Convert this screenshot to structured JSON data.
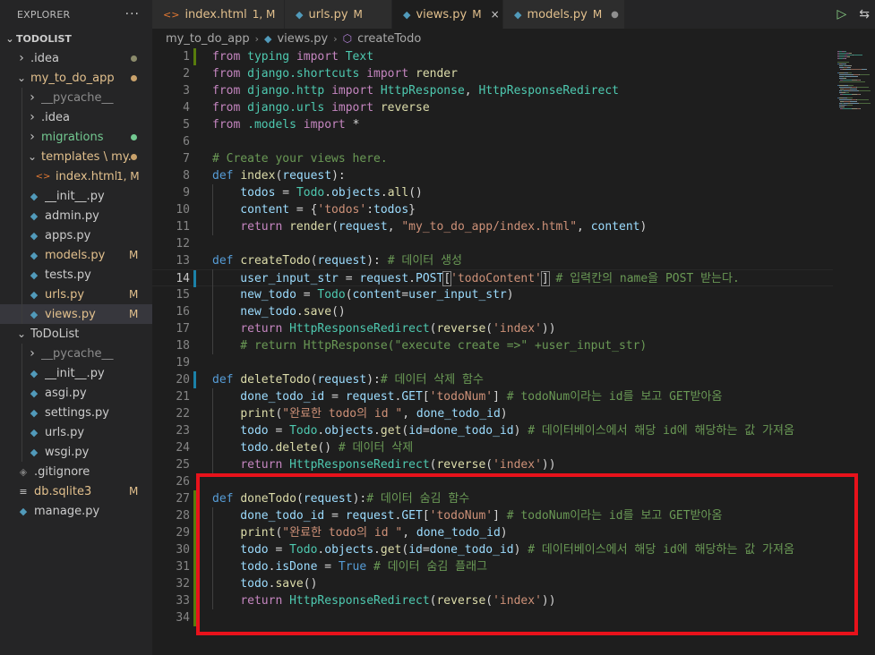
{
  "explorer": {
    "title": "EXPLORER",
    "more_icon": "ellipsis-icon",
    "root": "TODOLIST",
    "items": [
      {
        "label": ".idea",
        "kind": "folder",
        "open": false,
        "depth": 1,
        "color": "#cccccc",
        "dot": "#8b8b6b"
      },
      {
        "label": "my_to_do_app",
        "kind": "folder",
        "open": true,
        "depth": 1,
        "color": "#e2c08d",
        "dot": "#c9a26b"
      },
      {
        "label": "__pycache__",
        "kind": "folder",
        "open": false,
        "depth": 2,
        "color": "#8c8c8c"
      },
      {
        "label": ".idea",
        "kind": "folder",
        "open": false,
        "depth": 2,
        "color": "#cccccc"
      },
      {
        "label": "migrations",
        "kind": "folder",
        "open": false,
        "depth": 2,
        "color": "#73c991",
        "dot": "#73c991"
      },
      {
        "label": "templates \\ my...",
        "kind": "folder",
        "open": true,
        "depth": 2,
        "color": "#e2c08d",
        "dot": "#c9a26b"
      },
      {
        "label": "index.html",
        "kind": "html",
        "depth": 3,
        "color": "#e2c08d",
        "badge": "1, M",
        "badge_color": "#e2c08d"
      },
      {
        "label": "__init__.py",
        "kind": "py",
        "depth": 2,
        "color": "#cccccc"
      },
      {
        "label": "admin.py",
        "kind": "py",
        "depth": 2,
        "color": "#cccccc"
      },
      {
        "label": "apps.py",
        "kind": "py",
        "depth": 2,
        "color": "#cccccc"
      },
      {
        "label": "models.py",
        "kind": "py",
        "depth": 2,
        "color": "#e2c08d",
        "badge": "M",
        "badge_color": "#e2c08d"
      },
      {
        "label": "tests.py",
        "kind": "py",
        "depth": 2,
        "color": "#cccccc"
      },
      {
        "label": "urls.py",
        "kind": "py",
        "depth": 2,
        "color": "#e2c08d",
        "badge": "M",
        "badge_color": "#e2c08d"
      },
      {
        "label": "views.py",
        "kind": "py",
        "depth": 2,
        "color": "#e2c08d",
        "badge": "M",
        "badge_color": "#e2c08d",
        "selected": true
      },
      {
        "label": "ToDoList",
        "kind": "folder",
        "open": true,
        "depth": 1,
        "color": "#cccccc"
      },
      {
        "label": "__pycache__",
        "kind": "folder",
        "open": false,
        "depth": 2,
        "color": "#8c8c8c"
      },
      {
        "label": "__init__.py",
        "kind": "py",
        "depth": 2,
        "color": "#cccccc"
      },
      {
        "label": "asgi.py",
        "kind": "py",
        "depth": 2,
        "color": "#cccccc"
      },
      {
        "label": "settings.py",
        "kind": "py",
        "depth": 2,
        "color": "#cccccc"
      },
      {
        "label": "urls.py",
        "kind": "py",
        "depth": 2,
        "color": "#cccccc"
      },
      {
        "label": "wsgi.py",
        "kind": "py",
        "depth": 2,
        "color": "#cccccc"
      },
      {
        "label": ".gitignore",
        "kind": "file",
        "depth": 1,
        "color": "#cccccc"
      },
      {
        "label": "db.sqlite3",
        "kind": "db",
        "depth": 1,
        "color": "#e2c08d",
        "badge": "M",
        "badge_color": "#e2c08d"
      },
      {
        "label": "manage.py",
        "kind": "py",
        "depth": 1,
        "color": "#cccccc"
      }
    ]
  },
  "tabs": [
    {
      "label": "index.html",
      "badge": "1, M",
      "icon": "html-icon",
      "active": false,
      "close": "×"
    },
    {
      "label": "urls.py",
      "badge": "M",
      "icon": "python-icon",
      "active": false,
      "close": ""
    },
    {
      "label": "views.py",
      "badge": "M",
      "icon": "python-icon",
      "active": true,
      "close": "×"
    },
    {
      "label": "models.py",
      "badge": "M",
      "icon": "python-icon",
      "active": false,
      "close": "●"
    }
  ],
  "tab_actions": {
    "run": "▷",
    "compare": "⇆"
  },
  "breadcrumb": {
    "folder": "my_to_do_app",
    "file": "views.py",
    "symbol": "createTodo",
    "sep": "›"
  },
  "editor": {
    "current_line": 14,
    "lines": [
      [
        [
          "from ",
          "kc"
        ],
        [
          "typing ",
          "cls"
        ],
        [
          "import ",
          "kc"
        ],
        [
          "Text",
          "cls"
        ]
      ],
      [
        [
          "from ",
          "kc"
        ],
        [
          "django.shortcuts ",
          "cls"
        ],
        [
          "import ",
          "kc"
        ],
        [
          "render",
          "fn"
        ]
      ],
      [
        [
          "from ",
          "kc"
        ],
        [
          "django.http ",
          "cls"
        ],
        [
          "import ",
          "kc"
        ],
        [
          "HttpResponse",
          "cls"
        ],
        [
          ", ",
          "pl"
        ],
        [
          "HttpResponseRedirect",
          "cls"
        ]
      ],
      [
        [
          "from ",
          "kc"
        ],
        [
          "django.urls ",
          "cls"
        ],
        [
          "import ",
          "kc"
        ],
        [
          "reverse",
          "fn"
        ]
      ],
      [
        [
          "from ",
          "kc"
        ],
        [
          ".models ",
          "cls"
        ],
        [
          "import ",
          "kc"
        ],
        [
          "*",
          "pl"
        ]
      ],
      [],
      [
        [
          "# Create your views here.",
          "cm"
        ]
      ],
      [
        [
          "def ",
          "kw"
        ],
        [
          "index",
          "fn"
        ],
        [
          "(",
          "pl"
        ],
        [
          "request",
          "var"
        ],
        [
          "):",
          "pl"
        ]
      ],
      [
        [
          "    todos ",
          "var"
        ],
        [
          "= ",
          "pl"
        ],
        [
          "Todo",
          "cls"
        ],
        [
          ".",
          "pl"
        ],
        [
          "objects",
          "var"
        ],
        [
          ".",
          "pl"
        ],
        [
          "all",
          "fn"
        ],
        [
          "()",
          "pl"
        ]
      ],
      [
        [
          "    content ",
          "var"
        ],
        [
          "= {",
          "pl"
        ],
        [
          "'todos'",
          "str"
        ],
        [
          ":",
          "pl"
        ],
        [
          "todos",
          "var"
        ],
        [
          "}",
          "pl"
        ]
      ],
      [
        [
          "    ",
          "pl"
        ],
        [
          "return ",
          "kc"
        ],
        [
          "render",
          "fn"
        ],
        [
          "(",
          "pl"
        ],
        [
          "request",
          "var"
        ],
        [
          ", ",
          "pl"
        ],
        [
          "\"my_to_do_app/index.html\"",
          "str"
        ],
        [
          ", ",
          "pl"
        ],
        [
          "content",
          "var"
        ],
        [
          ")",
          "pl"
        ]
      ],
      [],
      [
        [
          "def ",
          "kw"
        ],
        [
          "createTodo",
          "fn"
        ],
        [
          "(",
          "pl"
        ],
        [
          "request",
          "var"
        ],
        [
          "): ",
          "pl"
        ],
        [
          "# 데이터 생성",
          "cm"
        ]
      ],
      [
        [
          "    user_input_str ",
          "var"
        ],
        [
          "= ",
          "pl"
        ],
        [
          "request",
          "var"
        ],
        [
          ".",
          "pl"
        ],
        [
          "POST",
          "var"
        ],
        [
          "[",
          "pl"
        ],
        [
          "'todoContent'",
          "str"
        ],
        [
          "] ",
          "pl"
        ],
        [
          "# 입력칸의 name을 POST 받는다.",
          "cm"
        ]
      ],
      [
        [
          "    new_todo ",
          "var"
        ],
        [
          "= ",
          "pl"
        ],
        [
          "Todo",
          "cls"
        ],
        [
          "(",
          "pl"
        ],
        [
          "content",
          "var"
        ],
        [
          "=",
          "pl"
        ],
        [
          "user_input_str",
          "var"
        ],
        [
          ")",
          "pl"
        ]
      ],
      [
        [
          "    new_todo",
          "var"
        ],
        [
          ".",
          "pl"
        ],
        [
          "save",
          "fn"
        ],
        [
          "()",
          "pl"
        ]
      ],
      [
        [
          "    ",
          "pl"
        ],
        [
          "return ",
          "kc"
        ],
        [
          "HttpResponseRedirect",
          "cls"
        ],
        [
          "(",
          "pl"
        ],
        [
          "reverse",
          "fn"
        ],
        [
          "(",
          "pl"
        ],
        [
          "'index'",
          "str"
        ],
        [
          "))",
          "pl"
        ]
      ],
      [
        [
          "    # return HttpResponse(\"execute create =>\" +user_input_str)",
          "cm"
        ]
      ],
      [],
      [
        [
          "def ",
          "kw"
        ],
        [
          "deleteTodo",
          "fn"
        ],
        [
          "(",
          "pl"
        ],
        [
          "request",
          "var"
        ],
        [
          "):",
          "pl"
        ],
        [
          "# 데이터 삭제 함수",
          "cm"
        ]
      ],
      [
        [
          "    done_todo_id ",
          "var"
        ],
        [
          "= ",
          "pl"
        ],
        [
          "request",
          "var"
        ],
        [
          ".",
          "pl"
        ],
        [
          "GET",
          "var"
        ],
        [
          "[",
          "pl"
        ],
        [
          "'todoNum'",
          "str"
        ],
        [
          "] ",
          "pl"
        ],
        [
          "# todoNum이라는 id를 보고 GET받아옴",
          "cm"
        ]
      ],
      [
        [
          "    ",
          "pl"
        ],
        [
          "print",
          "fn"
        ],
        [
          "(",
          "pl"
        ],
        [
          "\"완료한 todo의 id \"",
          "str"
        ],
        [
          ", ",
          "pl"
        ],
        [
          "done_todo_id",
          "var"
        ],
        [
          ")",
          "pl"
        ]
      ],
      [
        [
          "    todo ",
          "var"
        ],
        [
          "= ",
          "pl"
        ],
        [
          "Todo",
          "cls"
        ],
        [
          ".",
          "pl"
        ],
        [
          "objects",
          "var"
        ],
        [
          ".",
          "pl"
        ],
        [
          "get",
          "fn"
        ],
        [
          "(",
          "pl"
        ],
        [
          "id",
          "var"
        ],
        [
          "=",
          "pl"
        ],
        [
          "done_todo_id",
          "var"
        ],
        [
          ") ",
          "pl"
        ],
        [
          "# 데이터베이스에서 해당 id에 해당하는 값 가져옴",
          "cm"
        ]
      ],
      [
        [
          "    todo",
          "var"
        ],
        [
          ".",
          "pl"
        ],
        [
          "delete",
          "fn"
        ],
        [
          "() ",
          "pl"
        ],
        [
          "# 데이터 삭제",
          "cm"
        ]
      ],
      [
        [
          "    ",
          "pl"
        ],
        [
          "return ",
          "kc"
        ],
        [
          "HttpResponseRedirect",
          "cls"
        ],
        [
          "(",
          "pl"
        ],
        [
          "reverse",
          "fn"
        ],
        [
          "(",
          "pl"
        ],
        [
          "'index'",
          "str"
        ],
        [
          "))",
          "pl"
        ]
      ],
      [],
      [
        [
          "def ",
          "kw"
        ],
        [
          "doneTodo",
          "fn"
        ],
        [
          "(",
          "pl"
        ],
        [
          "request",
          "var"
        ],
        [
          "):",
          "pl"
        ],
        [
          "# 데이터 숨김 함수",
          "cm"
        ]
      ],
      [
        [
          "    done_todo_id ",
          "var"
        ],
        [
          "= ",
          "pl"
        ],
        [
          "request",
          "var"
        ],
        [
          ".",
          "pl"
        ],
        [
          "GET",
          "var"
        ],
        [
          "[",
          "pl"
        ],
        [
          "'todoNum'",
          "str"
        ],
        [
          "] ",
          "pl"
        ],
        [
          "# todoNum이라는 id를 보고 GET받아옴",
          "cm"
        ]
      ],
      [
        [
          "    ",
          "pl"
        ],
        [
          "print",
          "fn"
        ],
        [
          "(",
          "pl"
        ],
        [
          "\"완료한 todo의 id \"",
          "str"
        ],
        [
          ", ",
          "pl"
        ],
        [
          "done_todo_id",
          "var"
        ],
        [
          ")",
          "pl"
        ]
      ],
      [
        [
          "    todo ",
          "var"
        ],
        [
          "= ",
          "pl"
        ],
        [
          "Todo",
          "cls"
        ],
        [
          ".",
          "pl"
        ],
        [
          "objects",
          "var"
        ],
        [
          ".",
          "pl"
        ],
        [
          "get",
          "fn"
        ],
        [
          "(",
          "pl"
        ],
        [
          "id",
          "var"
        ],
        [
          "=",
          "pl"
        ],
        [
          "done_todo_id",
          "var"
        ],
        [
          ") ",
          "pl"
        ],
        [
          "# 데이터베이스에서 해당 id에 해당하는 값 가져옴",
          "cm"
        ]
      ],
      [
        [
          "    todo",
          "var"
        ],
        [
          ".",
          "pl"
        ],
        [
          "isDone ",
          "var"
        ],
        [
          "= ",
          "pl"
        ],
        [
          "True ",
          "kw"
        ],
        [
          "# 데이터 숨김 플래그",
          "cm"
        ]
      ],
      [
        [
          "    todo",
          "var"
        ],
        [
          ".",
          "pl"
        ],
        [
          "save",
          "fn"
        ],
        [
          "()",
          "pl"
        ]
      ],
      [
        [
          "    ",
          "pl"
        ],
        [
          "return ",
          "kc"
        ],
        [
          "HttpResponseRedirect",
          "cls"
        ],
        [
          "(",
          "pl"
        ],
        [
          "reverse",
          "fn"
        ],
        [
          "(",
          "pl"
        ],
        [
          "'index'",
          "str"
        ],
        [
          "))",
          "pl"
        ]
      ],
      []
    ],
    "gutter_added": [
      1,
      27,
      28,
      29,
      30,
      31,
      32,
      33,
      34
    ],
    "gutter_modified": [
      14,
      20
    ],
    "bracket_match_line": 14
  },
  "colors": {
    "added": "#587c0c",
    "modified": "#1b81a8",
    "annotation": "#e8121b"
  }
}
